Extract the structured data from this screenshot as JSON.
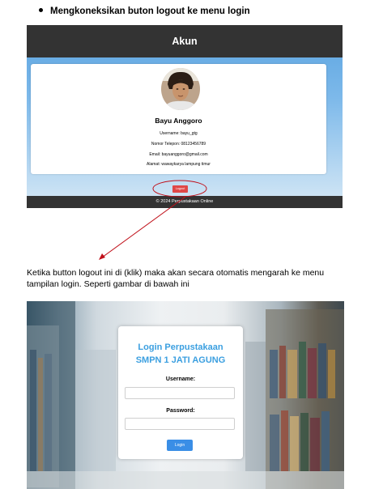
{
  "heading": "Mengkoneksikan buton logout ke menu login",
  "profile_page": {
    "title": "Akun",
    "name": "Bayu Anggoro",
    "username": "Username: bayu_gtg",
    "phone": "Nomor Telepon: 08123456789",
    "email": "Email: bayuanggoro@gmail.com",
    "address": "Alamat: wawaykarya lampung timur",
    "logout_label": "Logout",
    "footer": "© 2024 Perpustakaan Online"
  },
  "paragraph": "Ketika button logout ini di (klik) maka akan secara otomatis mengarah ke menu tampilan login. Seperti gambar di bawah ini",
  "login_page": {
    "title_line1": "Login Perpustakaan",
    "title_line2": "SMPN 1 JATI AGUNG",
    "username_label": "Username:",
    "password_label": "Password:",
    "login_label": "Login"
  },
  "colors": {
    "header_bg": "#333333",
    "logout_red": "#e04747",
    "login_blue": "#3a8ee6",
    "annotation_red": "#c0101a"
  }
}
